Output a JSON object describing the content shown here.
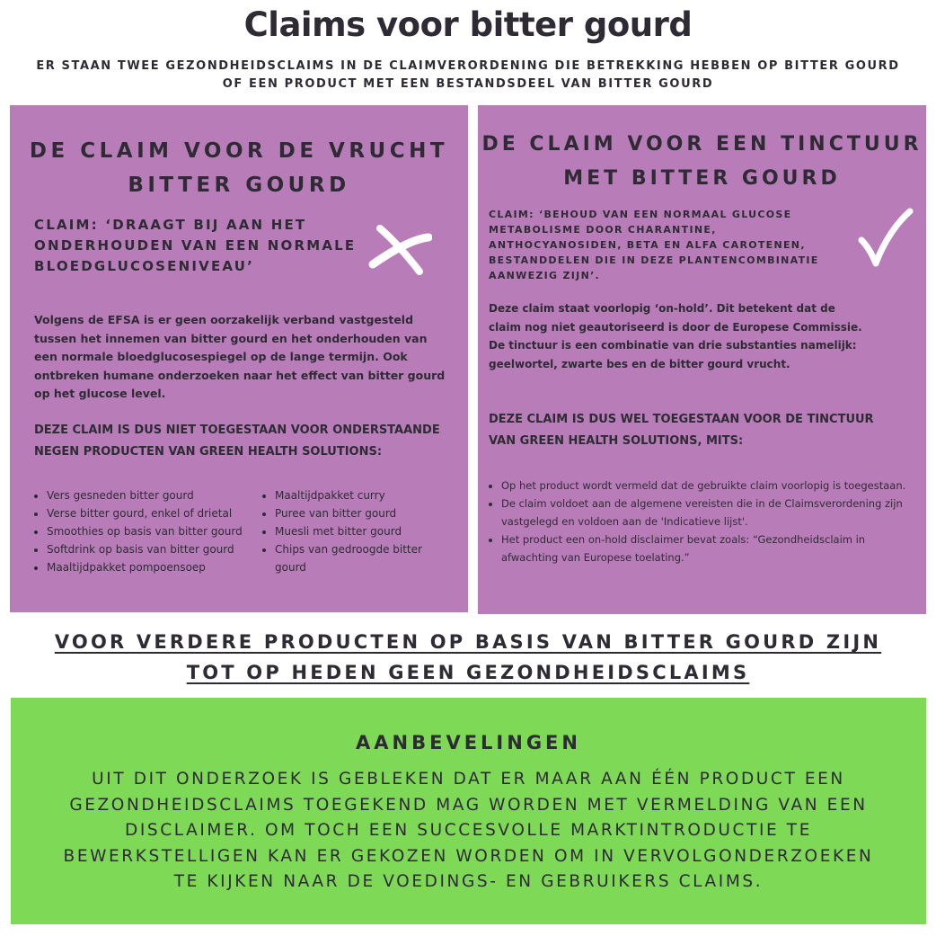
{
  "page": {
    "title": "Claims voor bitter gourd",
    "subtitle": "ER STAAN TWEE GEZONDHEIDSCLAIMS IN DE CLAIMVERORDENING DIE BETREKKING HEBBEN OP BITTER GOURD OF EEN PRODUCT MET EEN BESTANDSDEEL VAN BITTER GOURD"
  },
  "left_panel": {
    "heading_line1": "DE CLAIM VOOR DE VRUCHT",
    "heading_line2": "BITTER GOURD",
    "claim_line1": "CLAIM: ‘DRAAGT BIJ AAN HET",
    "claim_line2": "ONDERHOUDEN VAN EEN NORMALE",
    "claim_line3": "BLOEDGLUCOSENIVEAU’",
    "mark_icon": "cross-icon",
    "body_lines": [
      "Volgens de EFSA is er geen oorzakelijk verband vastgesteld",
      "tussen het innemen van bitter gourd en het onderhouden van",
      "een normale bloedglucosespiegel op de lange termijn. Ook",
      "ontbreken humane onderzoeken naar het effect van bitter gourd",
      "op het glucose level."
    ],
    "conclusion_line1": "DEZE CLAIM IS DUS NIET TOEGESTAAN VOOR ONDERSTAANDE",
    "conclusion_line2": "NEGEN PRODUCTEN VAN GREEN HEALTH SOLUTIONS:",
    "products_col1": [
      "Vers gesneden bitter gourd",
      "Verse bitter gourd, enkel of drietal",
      "Smoothies op basis van bitter gourd",
      "Softdrink op basis van bitter gourd",
      "Maaltijdpakket pompoensoep"
    ],
    "products_col2": [
      "Maaltijdpakket curry",
      "Puree van bitter gourd",
      "Muesli met bitter gourd",
      "Chips van gedroogde bitter gourd"
    ]
  },
  "right_panel": {
    "heading_line1": "DE CLAIM VOOR EEN TINCTUUR",
    "heading_line2": "MET BITTER GOURD",
    "claim_lines": [
      "CLAIM: ‘BEHOUD VAN EEN NORMAAL GLUCOSE",
      "METABOLISME DOOR CHARANTINE,",
      "ANTHOCYANOSIDEN, BETA EN ALFA CAROTENEN,",
      "BESTANDDELEN DIE IN DEZE PLANTENCOMBINATIE",
      "AANWEZIG ZIJN’."
    ],
    "mark_icon": "checkmark-icon",
    "body_lines": [
      "Deze  claim staat voorlopig ‘on-hold’. Dit betekent dat de",
      "claim nog niet geautoriseerd is door de Europese Commissie.",
      "De tinctuur is een combinatie van drie substanties namelijk:",
      "geelwortel, zwarte bes en de bitter gourd vrucht."
    ],
    "conclusion_line1": "DEZE CLAIM IS DUS WEL TOEGESTAAN VOOR DE TINCTUUR",
    "conclusion_line2": "VAN GREEN HEALTH SOLUTIONS, MITS:",
    "conditions": [
      "Op het product wordt vermeld dat de gebruikte claim voorlopig is toegestaan.",
      "De claim voldoet aan de algemene vereisten die in de Claimsverordening zijn vastgelegd en voldoen aan de 'Indicatieve lijst'.",
      "Het product een on-hold disclaimer bevat zoals: “Gezondheidsclaim in afwachting van Europese toelating.”"
    ]
  },
  "notice": {
    "line1": "VOOR VERDERE PRODUCTEN OP BASIS VAN BITTER GOURD ZIJN",
    "line2": "TOT OP HEDEN GEEN GEZONDHEIDSCLAIMS"
  },
  "recommendations": {
    "heading": "AANBEVELINGEN",
    "lines": [
      "UIT DIT ONDERZOEK IS GEBLEKEN DAT ER MAAR AAN ÉÉN PRODUCT EEN",
      "GEZONDHEIDSCLAIMS TOEGEKEND MAG WORDEN MET VERMELDING VAN EEN",
      "DISCLAIMER. OM TOCH EEN SUCCESVOLLE MARKTINTRODUCTIE TE",
      "BEWERKSTELLIGEN KAN ER GEKOZEN WORDEN OM IN VERVOLGONDERZOEKEN",
      "TE KIJKEN NAAR DE VOEDINGS- EN GEBRUIKERS CLAIMS."
    ]
  },
  "colors": {
    "panel": "#b87db8",
    "recommendation_box": "#7ed957",
    "text": "#2f2b35",
    "mark": "#ffffff"
  }
}
